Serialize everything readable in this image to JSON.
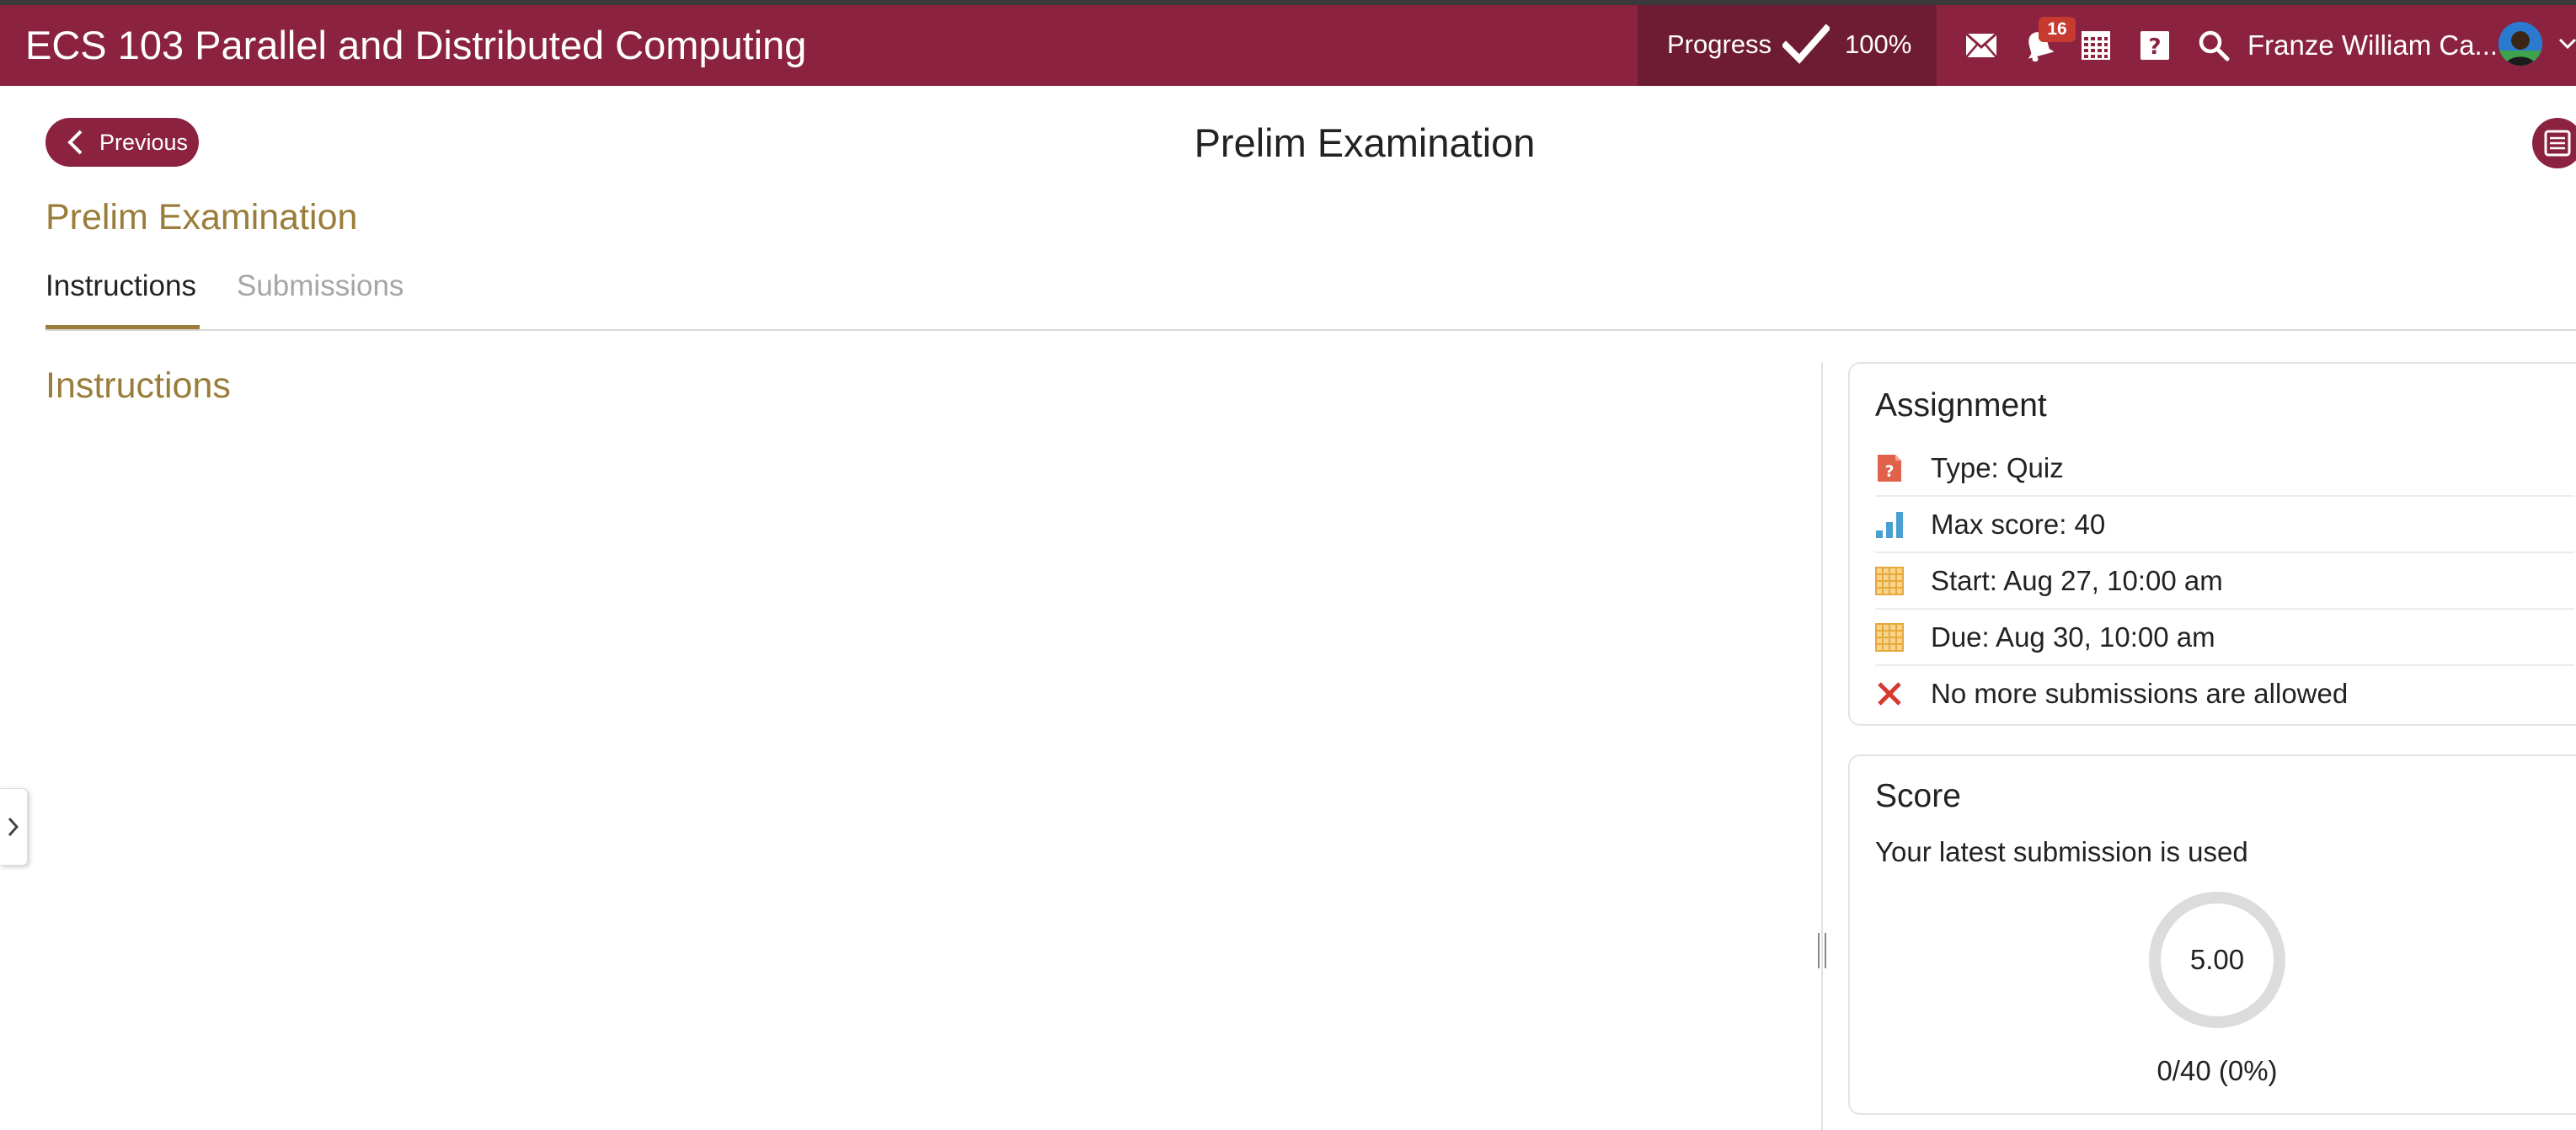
{
  "topbar": {
    "course_title": "ECS 103 Parallel and Distributed Computing",
    "progress_label": "Progress",
    "progress_value": "100%",
    "notification_count": "16",
    "user_name": "Franze William Ca...",
    "bar_color": "#8b2340",
    "icons": [
      "mail-icon",
      "bell-icon",
      "calendar-icon",
      "help-icon",
      "search-icon"
    ]
  },
  "header": {
    "previous_label": "Previous",
    "page_title": "Prelim Examination",
    "section_title": "Prelim Examination"
  },
  "tabs": [
    {
      "label": "Instructions",
      "active": true
    },
    {
      "label": "Submissions",
      "active": false
    }
  ],
  "main": {
    "instructions_heading": "Instructions"
  },
  "assignment": {
    "title": "Assignment",
    "rows": [
      {
        "icon": "quiz-icon",
        "text": "Type: Quiz"
      },
      {
        "icon": "bar-chart-icon",
        "text": "Max score: 40"
      },
      {
        "icon": "calendar-icon",
        "text": "Start: Aug 27, 10:00 am"
      },
      {
        "icon": "calendar-icon",
        "text": "Due: Aug 30, 10:00 am"
      },
      {
        "icon": "close-icon",
        "text": "No more submissions are allowed"
      }
    ]
  },
  "score": {
    "title": "Score",
    "subtitle": "Your latest submission is used",
    "value": "5.00",
    "total": "0/40 (0%)"
  },
  "colors": {
    "accent": "#8b2340",
    "gold": "#9a7d3a",
    "quiz_icon": "#e0624c",
    "chart_icon": "#4a9fd1",
    "calendar_icon": "#e6a93a",
    "close_icon": "#d63a2e"
  }
}
